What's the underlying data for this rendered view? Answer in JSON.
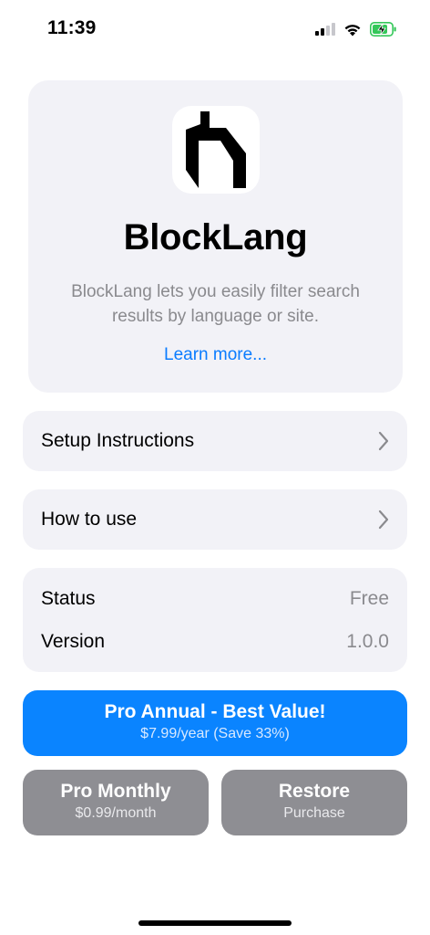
{
  "status_bar": {
    "time": "11:39"
  },
  "app": {
    "name": "BlockLang",
    "description": "BlockLang lets you easily filter search results by language or site.",
    "learn_more": "Learn more..."
  },
  "menu": {
    "setup": "Setup Instructions",
    "how_to": "How to use"
  },
  "info": {
    "status_label": "Status",
    "status_value": "Free",
    "version_label": "Version",
    "version_value": "1.0.0"
  },
  "purchase": {
    "annual_title": "Pro Annual - Best Value!",
    "annual_price": "$7.99/year (Save 33%)",
    "monthly_title": "Pro Monthly",
    "monthly_price": "$0.99/month",
    "restore_title": "Restore",
    "restore_sub": "Purchase"
  },
  "colors": {
    "accent": "#0a84ff",
    "link": "#0a7cff",
    "secondary_button": "#8e8e93",
    "card_bg": "#f2f2f7",
    "battery_fill": "#34c759"
  },
  "icons": [
    "signal-icon",
    "wifi-icon",
    "battery-charging-icon",
    "app-logo-icon",
    "chevron-right-icon"
  ]
}
